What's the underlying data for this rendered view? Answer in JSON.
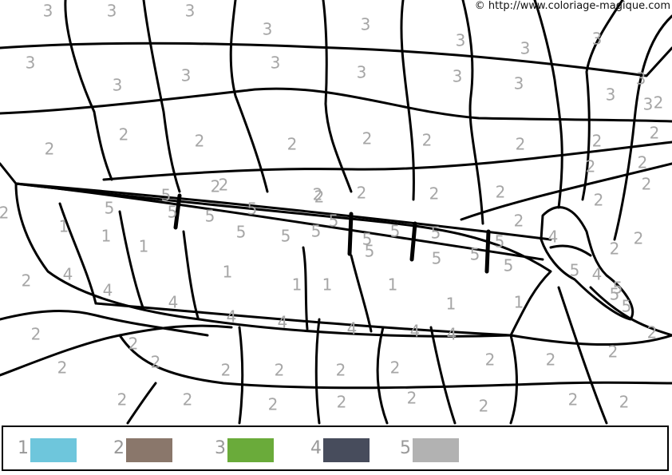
{
  "copyright": "© http://www.coloriage-magique.com",
  "legend": [
    {
      "number": "1",
      "color": "#6ec6dc"
    },
    {
      "number": "2",
      "color": "#8a776b"
    },
    {
      "number": "3",
      "color": "#6aab3a"
    },
    {
      "number": "4",
      "color": "#474c5c"
    },
    {
      "number": "5",
      "color": "#b2b2b2"
    }
  ],
  "region_labels": [
    "3",
    "3",
    "3",
    "3",
    "3",
    "3",
    "3",
    "3",
    "3",
    "3",
    "3",
    "3",
    "3",
    "3",
    "3",
    "3",
    "3",
    "3",
    "2",
    "2",
    "2",
    "2",
    "2",
    "2",
    "2",
    "2",
    "2",
    "2",
    "2",
    "2",
    "2",
    "2",
    "2",
    "2",
    "2",
    "2",
    "2",
    "2",
    "2",
    "2",
    "2",
    "2",
    "2",
    "2",
    "2",
    "2",
    "2",
    "2",
    "2",
    "2",
    "2",
    "2",
    "2",
    "2",
    "2",
    "2",
    "2",
    "2",
    "2",
    "2",
    "2",
    "2",
    "2",
    "2",
    "1",
    "1",
    "1",
    "1",
    "1",
    "1",
    "1",
    "1",
    "1",
    "4",
    "4",
    "4",
    "4",
    "4",
    "4",
    "4",
    "4",
    "4",
    "4",
    "5",
    "5",
    "5",
    "5",
    "5",
    "5",
    "5",
    "5",
    "5",
    "5",
    "5",
    "5",
    "5",
    "5",
    "5",
    "5",
    "5",
    "5",
    "5",
    "5",
    "5"
  ]
}
